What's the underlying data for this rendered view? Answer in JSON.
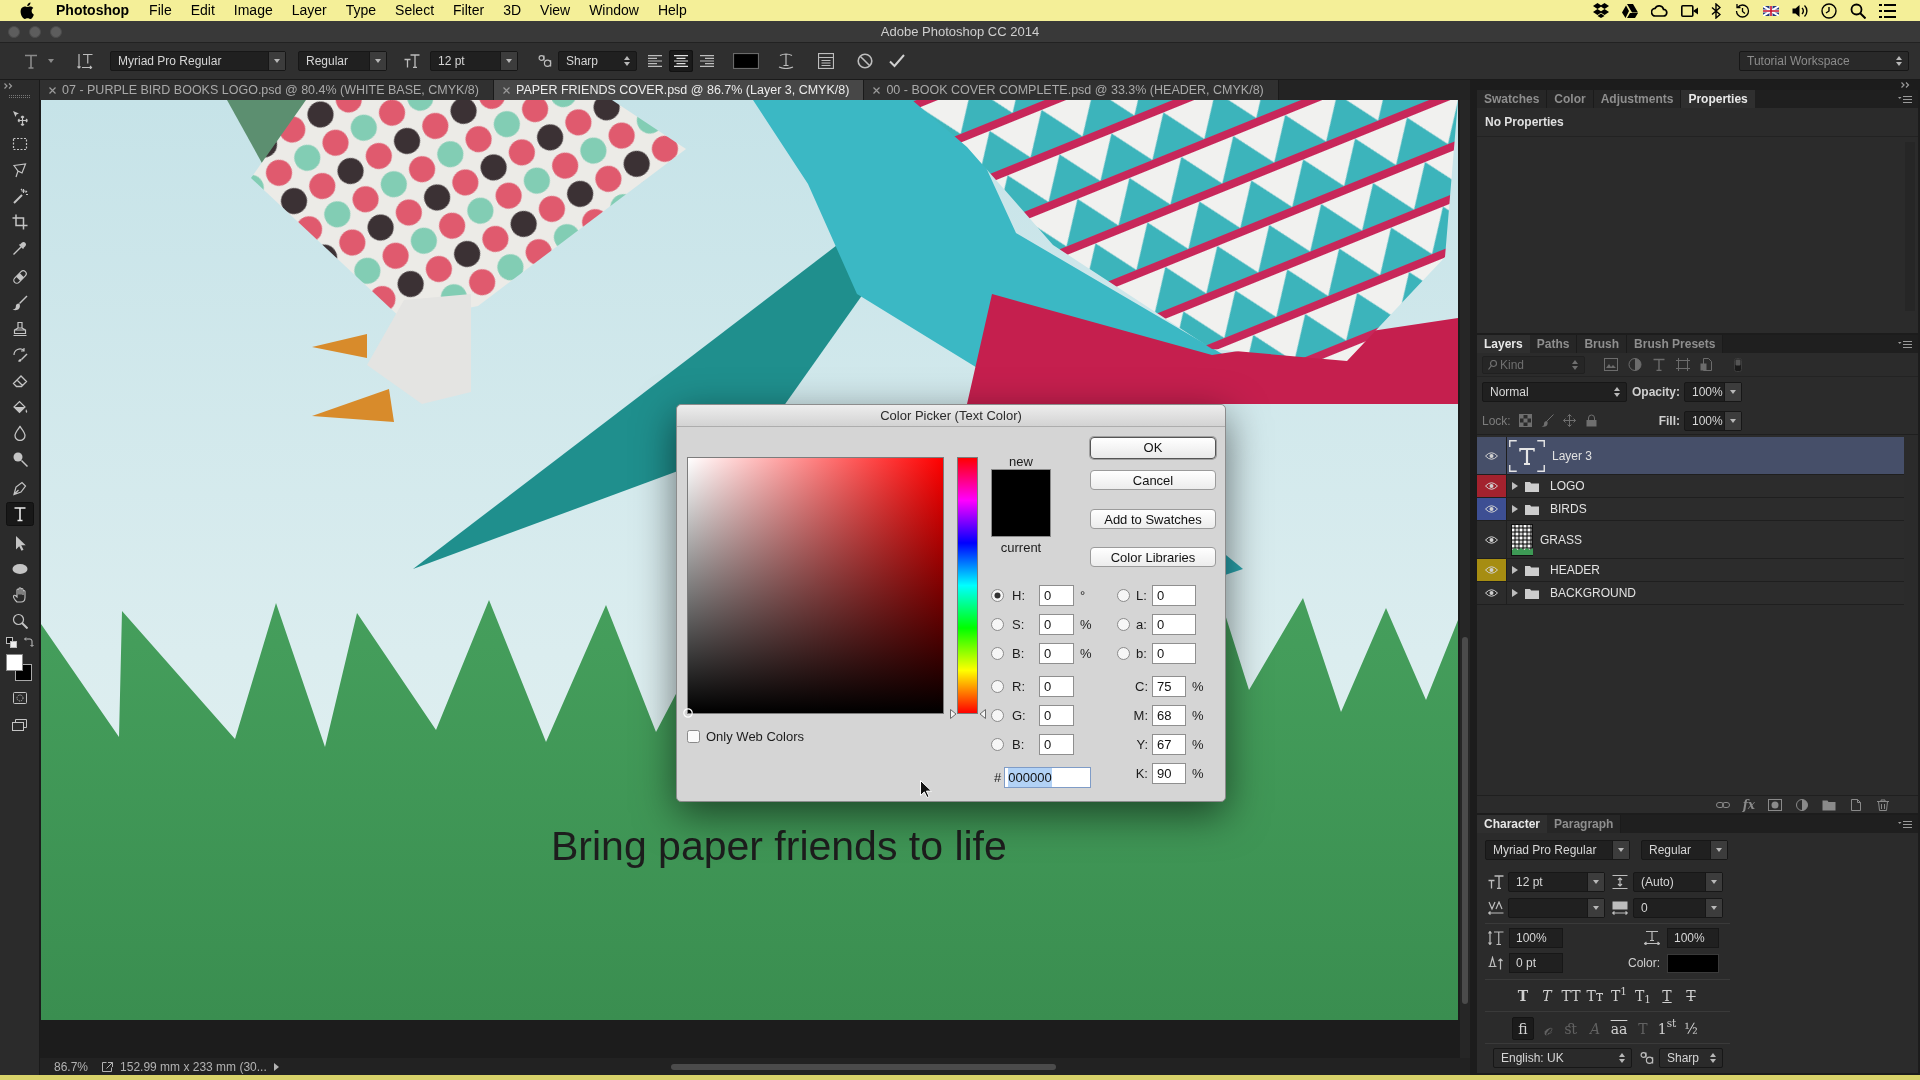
{
  "menu_bar": {
    "app_name": "Photoshop",
    "items": [
      "File",
      "Edit",
      "Image",
      "Layer",
      "Type",
      "Select",
      "Filter",
      "3D",
      "View",
      "Window",
      "Help"
    ]
  },
  "window": {
    "title": "Adobe Photoshop CC 2014"
  },
  "options_bar": {
    "font_family": "Myriad Pro Regular",
    "font_style": "Regular",
    "font_size": "12 pt",
    "anti_alias": "Sharp",
    "alignment": [
      {
        "kind": "left",
        "selected": false
      },
      {
        "kind": "center",
        "selected": true
      },
      {
        "kind": "right",
        "selected": false
      }
    ],
    "workspace": "Tutorial Workspace"
  },
  "document_tabs": [
    {
      "title": "07 - PURPLE BIRD BOOKS LOGO.psd @ 80.4% (WHITE BASE, CMYK/8)",
      "selected": false
    },
    {
      "title": "PAPER FRIENDS COVER.psd @ 86.7% (Layer 3, CMYK/8)",
      "selected": true
    },
    {
      "title": "00 - BOOK COVER COMPLETE.psd @ 33.3% (HEADER, CMYK/8)",
      "selected": false
    }
  ],
  "tools": [
    {
      "kind": "move",
      "selected": false
    },
    {
      "kind": "marquee",
      "selected": false
    },
    {
      "kind": "lasso",
      "selected": false
    },
    {
      "kind": "magic-wand",
      "selected": false
    },
    {
      "kind": "crop",
      "selected": false
    },
    {
      "kind": "eyedropper",
      "selected": false
    },
    {
      "kind": "healing",
      "selected": false
    },
    {
      "kind": "brush",
      "selected": false
    },
    {
      "kind": "stamp",
      "selected": false
    },
    {
      "kind": "history-brush",
      "selected": false
    },
    {
      "kind": "eraser",
      "selected": false
    },
    {
      "kind": "bucket",
      "selected": false
    },
    {
      "kind": "blur",
      "selected": false
    },
    {
      "kind": "dodge",
      "selected": false
    },
    {
      "kind": "pen",
      "selected": false
    },
    {
      "kind": "type",
      "selected": true
    },
    {
      "kind": "path-select",
      "selected": false
    },
    {
      "kind": "ellipse",
      "selected": false
    },
    {
      "kind": "hand",
      "selected": false
    },
    {
      "kind": "zoom",
      "selected": false
    }
  ],
  "canvas": {
    "text": "Bring paper friends to life"
  },
  "color_picker": {
    "title": "Color Picker (Text Color)",
    "new_label": "new",
    "current_label": "current",
    "buttons": [
      {
        "label": "OK",
        "kind": "default"
      },
      {
        "label": "Cancel",
        "kind": "normal"
      },
      {
        "label": "Add to Swatches",
        "kind": "normal"
      },
      {
        "label": "Color Libraries",
        "kind": "normal"
      }
    ],
    "hue_slider": {
      "level": 0
    },
    "hsb_rgb": [
      {
        "label": "H:",
        "value": "0",
        "unit": "°",
        "selected": true
      },
      {
        "label": "S:",
        "value": "0",
        "unit": "%",
        "selected": false
      },
      {
        "label": "B:",
        "value": "0",
        "unit": "%",
        "selected": false
      },
      {
        "label": "R:",
        "value": "0",
        "selected": false
      },
      {
        "label": "G:",
        "value": "0",
        "selected": false
      },
      {
        "label": "B:",
        "value": "0",
        "selected": false
      }
    ],
    "lab": [
      {
        "label": "L:",
        "value": "0",
        "selected": false
      },
      {
        "label": "a:",
        "value": "0",
        "selected": false
      },
      {
        "label": "b:",
        "value": "0",
        "selected": false
      }
    ],
    "cmyk": [
      {
        "label": "C:",
        "value": "75",
        "unit": "%"
      },
      {
        "label": "M:",
        "value": "68",
        "unit": "%"
      },
      {
        "label": "Y:",
        "value": "67",
        "unit": "%"
      },
      {
        "label": "K:",
        "value": "90",
        "unit": "%"
      }
    ],
    "hex": {
      "label": "#",
      "value": "000000",
      "text_selected": true
    },
    "only_web_colors": {
      "label": "Only Web Colors",
      "checked": false
    }
  },
  "status_bar": {
    "zoom": "86.7%",
    "document_info": "152.99 mm x 233 mm (30..."
  },
  "properties_panel": {
    "tabs": [
      {
        "label": "Swatches",
        "selected": false
      },
      {
        "label": "Color",
        "selected": false
      },
      {
        "label": "Adjustments",
        "selected": false
      },
      {
        "label": "Properties",
        "selected": true
      }
    ],
    "message": "No Properties"
  },
  "layers_panel": {
    "tabs": [
      {
        "label": "Layers",
        "selected": true
      },
      {
        "label": "Paths",
        "selected": false
      },
      {
        "label": "Brush",
        "selected": false
      },
      {
        "label": "Brush Presets",
        "selected": false
      }
    ],
    "filter": "Kind",
    "blend_mode": "Normal",
    "opacity_label": "Opacity:",
    "opacity": "100%",
    "lock_label": "Lock:",
    "fill_label": "Fill:",
    "fill": "100%",
    "layers": [
      {
        "name": "Layer 3",
        "kind": "text",
        "selected": true,
        "visible": true
      },
      {
        "name": "LOGO",
        "kind": "group",
        "selected": false,
        "visible": true,
        "expanded": false,
        "color": "#a3222e"
      },
      {
        "name": "BIRDS",
        "kind": "group",
        "selected": false,
        "visible": true,
        "expanded": false,
        "color": "#3d4f93"
      },
      {
        "name": "GRASS",
        "kind": "pixel",
        "selected": false,
        "visible": true
      },
      {
        "name": "HEADER",
        "kind": "group",
        "selected": false,
        "visible": true,
        "expanded": false,
        "color": "#a68d12"
      },
      {
        "name": "BACKGROUND",
        "kind": "group",
        "selected": false,
        "visible": true,
        "expanded": false
      }
    ],
    "effects_label": "fx"
  },
  "character_panel": {
    "tabs": [
      {
        "label": "Character",
        "selected": true
      },
      {
        "label": "Paragraph",
        "selected": false
      }
    ],
    "font_family": "Myriad Pro Regular",
    "font_style": "Regular",
    "font_size": "12 pt",
    "leading": "(Auto)",
    "tracking": "0",
    "vertical_scale": "100%",
    "horizontal_scale": "100%",
    "baseline_shift": "0 pt",
    "color_label": "Color:",
    "type_styles": [
      {
        "kind": "bold",
        "label": "T"
      },
      {
        "kind": "italic",
        "label": "T"
      },
      {
        "kind": "all-caps",
        "label": "TT"
      },
      {
        "kind": "small-caps",
        "label": "Tᴛ"
      },
      {
        "kind": "superscript",
        "label": "T$^{1}$"
      },
      {
        "kind": "subscript",
        "label": "T$_{1}$"
      },
      {
        "kind": "underline",
        "label": "T"
      },
      {
        "kind": "strikethrough",
        "label": "T"
      }
    ],
    "opentype": [
      {
        "kind": "ligature",
        "label": "ﬁ",
        "selected": true,
        "disabled": false
      },
      {
        "kind": "contextual",
        "label": "ℴ",
        "selected": false,
        "disabled": true
      },
      {
        "kind": "discretionary",
        "label": "ﬆ",
        "selected": false,
        "disabled": true
      },
      {
        "kind": "swash",
        "label": "A",
        "selected": false,
        "disabled": true
      },
      {
        "kind": "stylistic",
        "label": "aa",
        "selected": false,
        "disabled": false
      },
      {
        "kind": "titling",
        "label": "T",
        "selected": false,
        "disabled": true
      },
      {
        "kind": "ordinal",
        "label": "1$^{st}$",
        "selected": false,
        "disabled": false
      },
      {
        "kind": "fraction",
        "label": "½",
        "selected": false,
        "disabled": false
      }
    ],
    "language": "English: UK",
    "anti_alias": "Sharp"
  }
}
